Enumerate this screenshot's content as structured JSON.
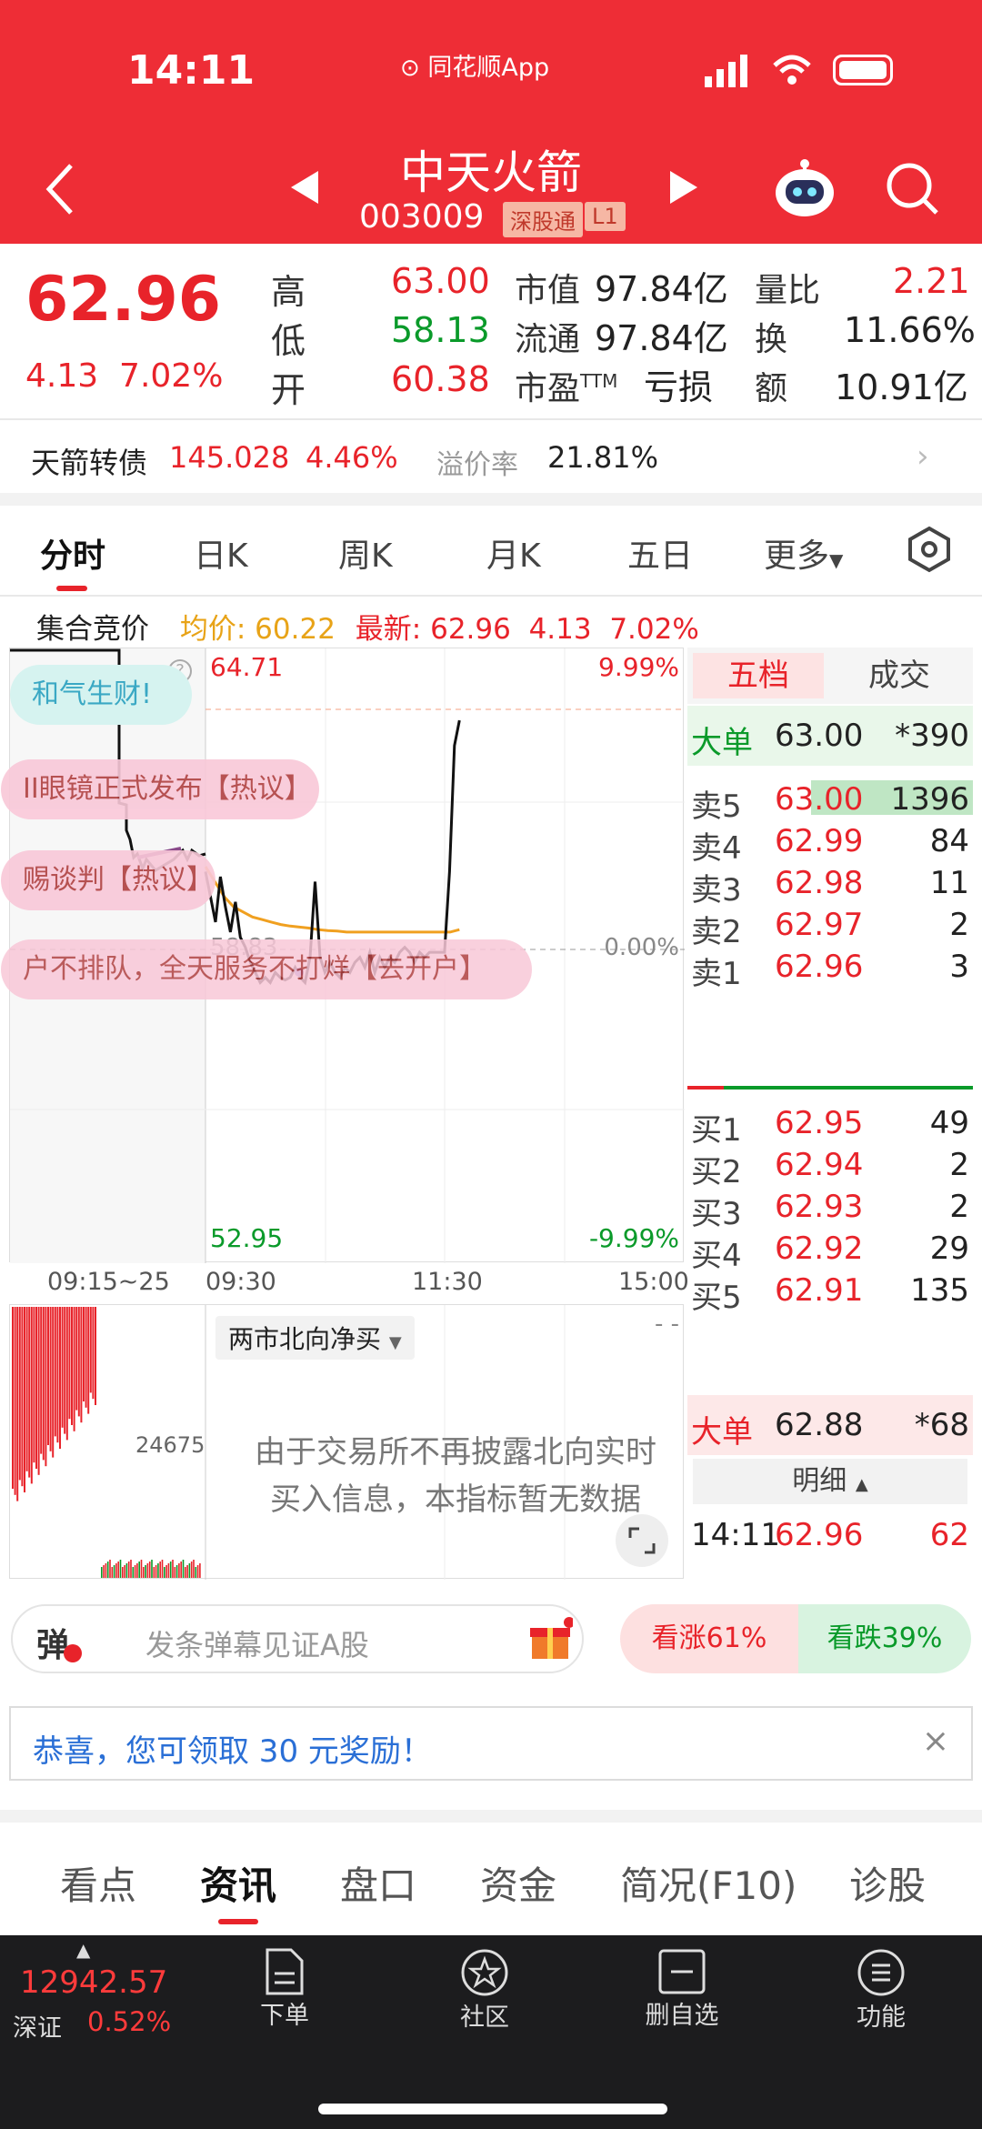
{
  "status": {
    "time": "14:11",
    "app": "同花顺App"
  },
  "header": {
    "name": "中天火箭",
    "code": "003009",
    "tag_connect": "深股通",
    "tag_level": "L1"
  },
  "quote": {
    "price": "62.96",
    "change": "4.13",
    "pct": "7.02%",
    "high_l": "高",
    "high": "63.00",
    "low_l": "低",
    "low": "58.13",
    "open_l": "开",
    "open": "60.38",
    "cap_l": "市值",
    "cap": "97.84亿",
    "float_l": "流通",
    "float": "97.84亿",
    "pe_l": "市盈",
    "pe_sup": "TTM",
    "pe": "亏损",
    "ratio_l": "量比",
    "ratio": "2.21",
    "turn_l": "换",
    "turn": "11.66%",
    "amt_l": "额",
    "amt": "10.91亿"
  },
  "bond": {
    "name": "天箭转债",
    "price": "145.028",
    "pct": "4.46%",
    "prem_l": "溢价率",
    "prem": "21.81%"
  },
  "tabs": [
    "分时",
    "日K",
    "周K",
    "月K",
    "五日",
    "更多"
  ],
  "chart_info": {
    "auction": "集合竞价",
    "avg_l": "均价:",
    "avg": "60.22",
    "last_l": "最新:",
    "last": "62.96",
    "chg": "4.13",
    "pct": "7.02%"
  },
  "chart_labels": {
    "top": "64.71",
    "top_pct": "9.99%",
    "mid": "58.83",
    "mid_pct": "0.00%",
    "bot": "52.95",
    "bot_pct": "-9.99%",
    "t0": "09:15~25",
    "t1": "09:30",
    "t2": "11:30",
    "t3": "15:00"
  },
  "banners": [
    "和气生财!",
    "II眼镜正式发布【热议】",
    "赐谈判【热议】",
    "户不排队，全天服务不打烊【去开户】"
  ],
  "chart_data": {
    "type": "line",
    "x_range": [
      "09:30",
      "15:00"
    ],
    "ylim": [
      52.95,
      64.71
    ],
    "prev_close": 58.83,
    "series": [
      {
        "name": "price",
        "values": [
          60.5,
          60.0,
          59.5,
          60.4,
          59.8,
          59.3,
          59.9,
          59.2,
          59.0,
          58.7,
          58.5,
          58.3,
          58.4,
          58.3,
          58.5,
          58.4,
          58.35,
          58.4,
          58.6,
          58.4,
          58.3,
          58.8,
          60.3,
          58.8,
          58.5,
          58.7,
          58.5,
          58.4,
          58.6,
          58.5,
          58.7,
          58.8,
          58.6,
          58.9,
          58.5,
          58.8,
          58.6,
          58.8,
          58.7,
          58.9,
          59.0,
          58.9,
          58.7,
          58.9,
          58.8,
          58.9,
          58.9,
          58.9,
          58.9,
          60.5,
          63.0,
          63.5
        ]
      },
      {
        "name": "avg",
        "values": [
          60.6,
          60.3,
          60.0,
          59.8,
          59.7,
          59.6,
          59.55,
          59.5,
          59.45,
          59.42,
          59.4,
          59.38,
          59.35,
          59.33,
          59.32,
          59.3,
          59.3,
          59.3,
          59.3,
          59.3,
          59.3,
          59.3,
          59.3,
          59.3,
          59.3,
          59.3,
          59.3,
          59.35
        ]
      }
    ]
  },
  "orderbook": {
    "tab1": "五档",
    "tab2": "成交",
    "big_sell": {
      "l": "大单",
      "p": "63.00",
      "v": "*390"
    },
    "sells": [
      {
        "l": "卖5",
        "p": "63.00",
        "v": "1396"
      },
      {
        "l": "卖4",
        "p": "62.99",
        "v": "84"
      },
      {
        "l": "卖3",
        "p": "62.98",
        "v": "11"
      },
      {
        "l": "卖2",
        "p": "62.97",
        "v": "2"
      },
      {
        "l": "卖1",
        "p": "62.96",
        "v": "3"
      }
    ],
    "buys": [
      {
        "l": "买1",
        "p": "62.95",
        "v": "49"
      },
      {
        "l": "买2",
        "p": "62.94",
        "v": "2"
      },
      {
        "l": "买3",
        "p": "62.93",
        "v": "2"
      },
      {
        "l": "买4",
        "p": "62.92",
        "v": "29"
      },
      {
        "l": "买5",
        "p": "62.91",
        "v": "135"
      }
    ],
    "big_buy": {
      "l": "大单",
      "p": "62.88",
      "v": "*68"
    },
    "detail": "明细",
    "trade": {
      "t": "14:11",
      "p": "62.96",
      "v": "62"
    }
  },
  "vol": {
    "indicator": "两市北向净买",
    "value": "24675",
    "msg1": "由于交易所不再披露北向实时",
    "msg2": "买入信息，本指标暂无数据",
    "dash": "- -"
  },
  "danmu": {
    "icon": "弹",
    "placeholder": "发条弹幕见证A股",
    "up": "看涨61%",
    "down": "看跌39%"
  },
  "notice": {
    "text": "恭喜，您可领取 30 元奖励！"
  },
  "bnav": [
    "看点",
    "资讯",
    "盘口",
    "资金",
    "简况(F10)",
    "诊股"
  ],
  "footer": {
    "index": "12942.57",
    "index_name": "深证",
    "index_pct": "0.52%",
    "order": "下单",
    "community": "社区",
    "delete": "删自选",
    "func": "功能"
  }
}
